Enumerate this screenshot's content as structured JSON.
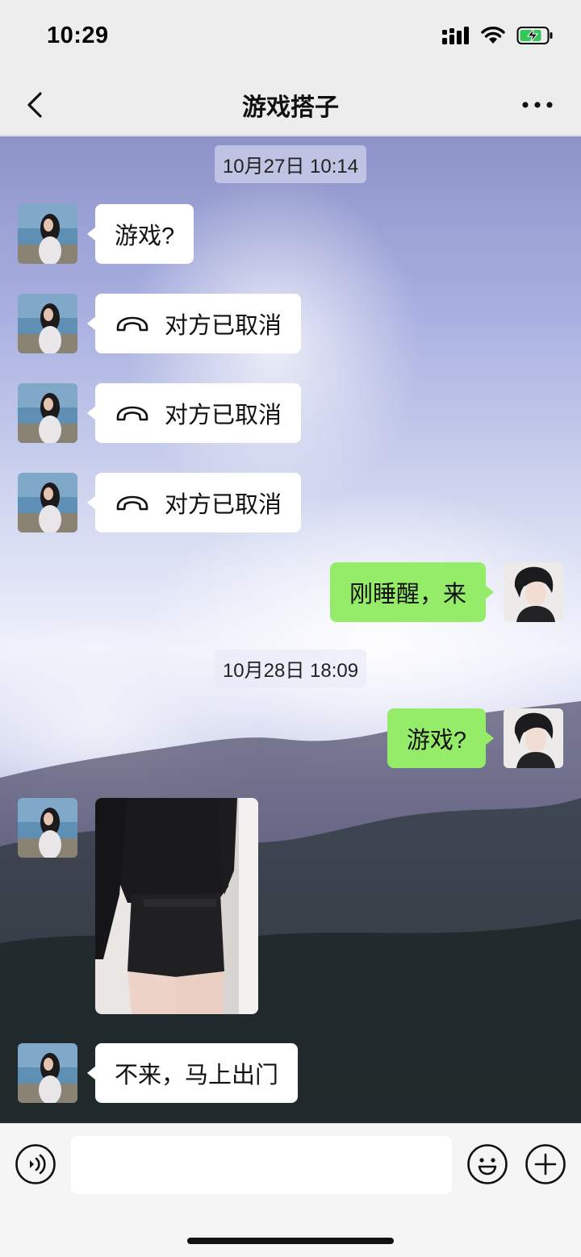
{
  "status_bar": {
    "time": "10:29"
  },
  "header": {
    "title": "游戏搭子"
  },
  "messages": [
    {
      "type": "timestamp",
      "text": "10月27日 10:14"
    },
    {
      "type": "text",
      "side": "left",
      "text": "游戏?"
    },
    {
      "type": "call",
      "side": "left",
      "text": "对方已取消"
    },
    {
      "type": "call",
      "side": "left",
      "text": "对方已取消"
    },
    {
      "type": "call",
      "side": "left",
      "text": "对方已取消"
    },
    {
      "type": "text",
      "side": "right",
      "text": "刚睡醒，来"
    },
    {
      "type": "timestamp",
      "text": "10月28日 18:09"
    },
    {
      "type": "text",
      "side": "right",
      "text": "游戏?"
    },
    {
      "type": "image",
      "side": "left"
    },
    {
      "type": "text",
      "side": "left",
      "text": "不来，马上出门"
    }
  ],
  "input_bar": {
    "value": ""
  },
  "icons": {
    "back": "chevron-left-icon",
    "more": "more-dots-icon",
    "call": "hang-up-phone-icon",
    "voice": "voice-icon",
    "emoji": "emoji-icon",
    "plus": "plus-icon"
  },
  "colors": {
    "sent_bubble": "#95ec69",
    "received_bubble": "#ffffff",
    "battery": "#34c759"
  }
}
